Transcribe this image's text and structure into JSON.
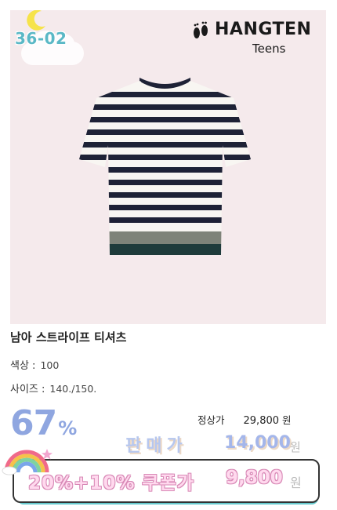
{
  "badge": {
    "code": "36-02"
  },
  "brand": {
    "name": "HANGTEN",
    "sub": "Teens"
  },
  "product": {
    "title": "남아 스트라이프 티셔츠",
    "specs": [
      {
        "label": "색상 :",
        "value": "100"
      },
      {
        "label": "사이즈 :",
        "value": "140./150."
      }
    ]
  },
  "pricing": {
    "discount_number": "67",
    "discount_symbol": "%",
    "regular_label": "정상가",
    "regular_value": "29,800",
    "regular_unit": "원",
    "sale_label": "판매가",
    "sale_value": "14,000",
    "sale_unit": "원",
    "coupon_label": "20%+10% 쿠폰가",
    "coupon_value": "9,800",
    "coupon_unit": "원"
  },
  "colors": {
    "hero_bg": "#f5eaec",
    "discount": "#8fa6e0",
    "coupon_pink": "#f5a4d0",
    "coupon_teal": "#67cbcf",
    "stripe_navy": "#1e2236"
  },
  "icons": [
    "moon-icon",
    "cloud-icon",
    "footprints-icon",
    "rainbow-icon"
  ]
}
